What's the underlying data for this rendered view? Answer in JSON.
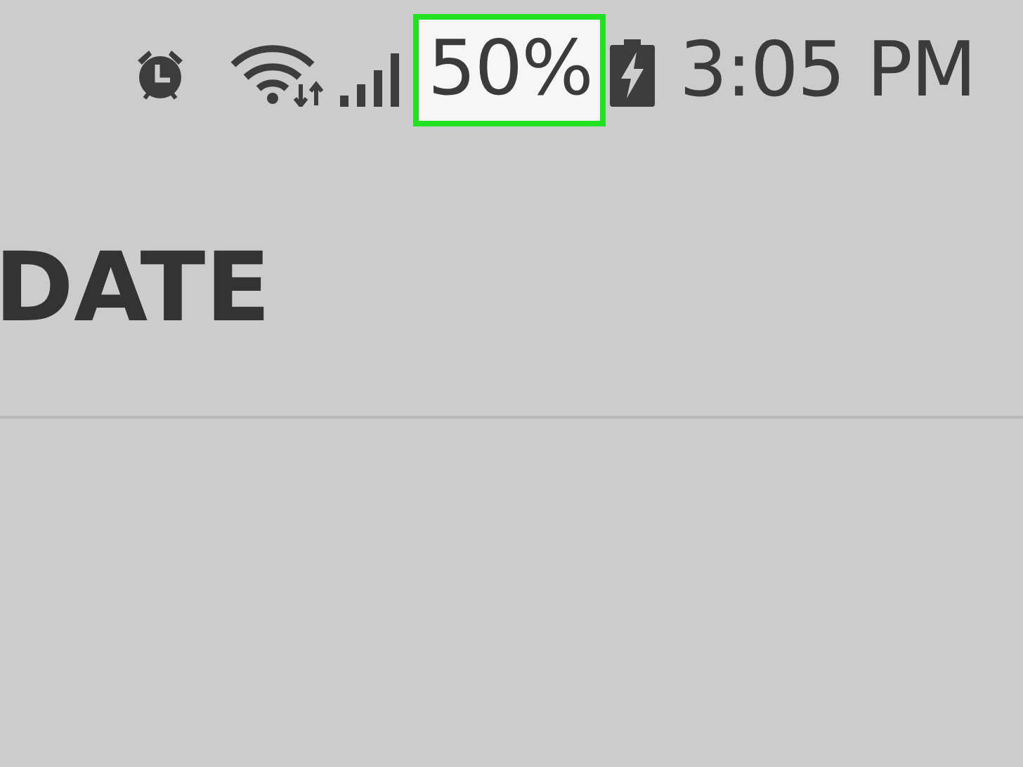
{
  "status_bar": {
    "battery_percent": {
      "text": "50%",
      "highlighted": true
    },
    "charging": true,
    "time": "3:05 PM"
  },
  "header": {
    "title": "DATE"
  }
}
